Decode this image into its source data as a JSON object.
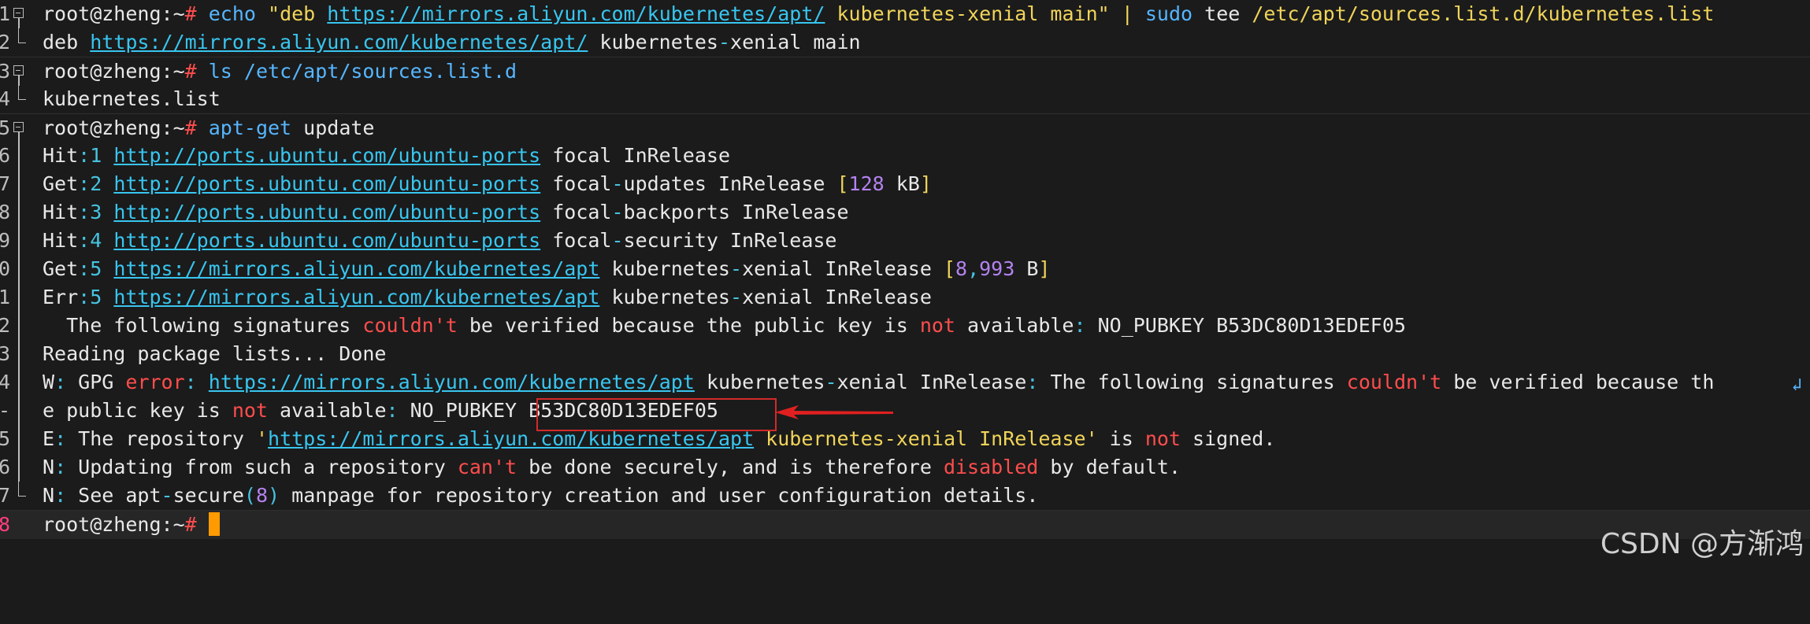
{
  "gutter_numbers": [
    "1",
    "2",
    "3",
    "4",
    "5",
    "6",
    "7",
    "8",
    "9",
    "0",
    "1",
    "2",
    "3",
    "4",
    "-",
    "5",
    "6",
    "7",
    "8"
  ],
  "prompt": "root@zheng:~",
  "prompt_hash": "#",
  "lines": {
    "l1": [
      "echo",
      " ",
      "\"deb ",
      "https://mirrors.aliyun.com/kubernetes/apt/",
      " kubernetes-xenial main\"",
      " ",
      "|",
      " ",
      "sudo",
      " tee ",
      "/etc/apt/sources.list.d/kubernetes.list"
    ],
    "l2": [
      "deb ",
      "https://mirrors.aliyun.com/kubernetes/apt/",
      " kubernetes",
      "-",
      "xenial main"
    ],
    "l3": [
      "ls",
      " ",
      "/etc/apt/sources.list.d"
    ],
    "l4": [
      "kubernetes.list"
    ],
    "l5": [
      "apt-get",
      " update"
    ],
    "l6": [
      "Hit",
      ":1 ",
      "http://ports.ubuntu.com/ubuntu-ports",
      " focal InRelease"
    ],
    "l7": [
      "Get",
      ":2 ",
      "http://ports.ubuntu.com/ubuntu-ports",
      " focal",
      "-",
      "updates InRelease ",
      "[",
      "128",
      " kB",
      "]"
    ],
    "l8": [
      "Hit",
      ":3 ",
      "http://ports.ubuntu.com/ubuntu-ports",
      " focal",
      "-",
      "backports InRelease"
    ],
    "l9": [
      "Hit",
      ":4 ",
      "http://ports.ubuntu.com/ubuntu-ports",
      " focal",
      "-",
      "security InRelease"
    ],
    "l10": [
      "Get",
      ":5 ",
      "https://mirrors.aliyun.com/kubernetes/apt",
      " kubernetes",
      "-",
      "xenial InRelease ",
      "[",
      "8",
      ",",
      "993",
      " B",
      "]"
    ],
    "l11": [
      "Err",
      ":5 ",
      "https://mirrors.aliyun.com/kubernetes/apt",
      " kubernetes",
      "-",
      "xenial InRelease"
    ],
    "l12": [
      "  The following signatures ",
      "couldn't",
      " be verified because the public key is ",
      "not",
      " available",
      ":",
      " NO_PUBKEY B53DC80D13EDEF05"
    ],
    "l13": [
      "Reading package lists... Done"
    ],
    "l14": [
      "W",
      ":",
      " GPG ",
      "error",
      ":",
      " ",
      "https://mirrors.aliyun.com/kubernetes/apt",
      " kubernetes",
      "-",
      "xenial InRelease",
      ":",
      " The following signatures ",
      "couldn't",
      " be verified because th"
    ],
    "l14b": [
      "e public key is ",
      "not",
      " available",
      ":",
      " NO_PUBKEY ",
      "B53DC80D13EDEF05"
    ],
    "l15": [
      "E",
      ":",
      " The repository ",
      "'",
      "https://mirrors.aliyun.com/kubernetes/apt",
      " kubernetes-xenial InRelease",
      "'",
      " is ",
      "not",
      " signed."
    ],
    "l16": [
      "N",
      ":",
      " Updating from such a repository ",
      "can't",
      " be done securely, and is therefore ",
      "disabled",
      " by default."
    ],
    "l17": [
      "N",
      ":",
      " See apt",
      "-",
      "secure",
      "(",
      "8",
      ")",
      " manpage for repository creation and user configuration details."
    ]
  },
  "wrap_icon": "wrap-arrow-icon",
  "watermark": "CSDN @方渐鸿",
  "colors": {
    "background": "#1b1b1b",
    "url": "#38c6f0",
    "error_red": "#ff4d4d",
    "cursor": "#ff9a00",
    "highlight_border": "#d22a2a"
  }
}
